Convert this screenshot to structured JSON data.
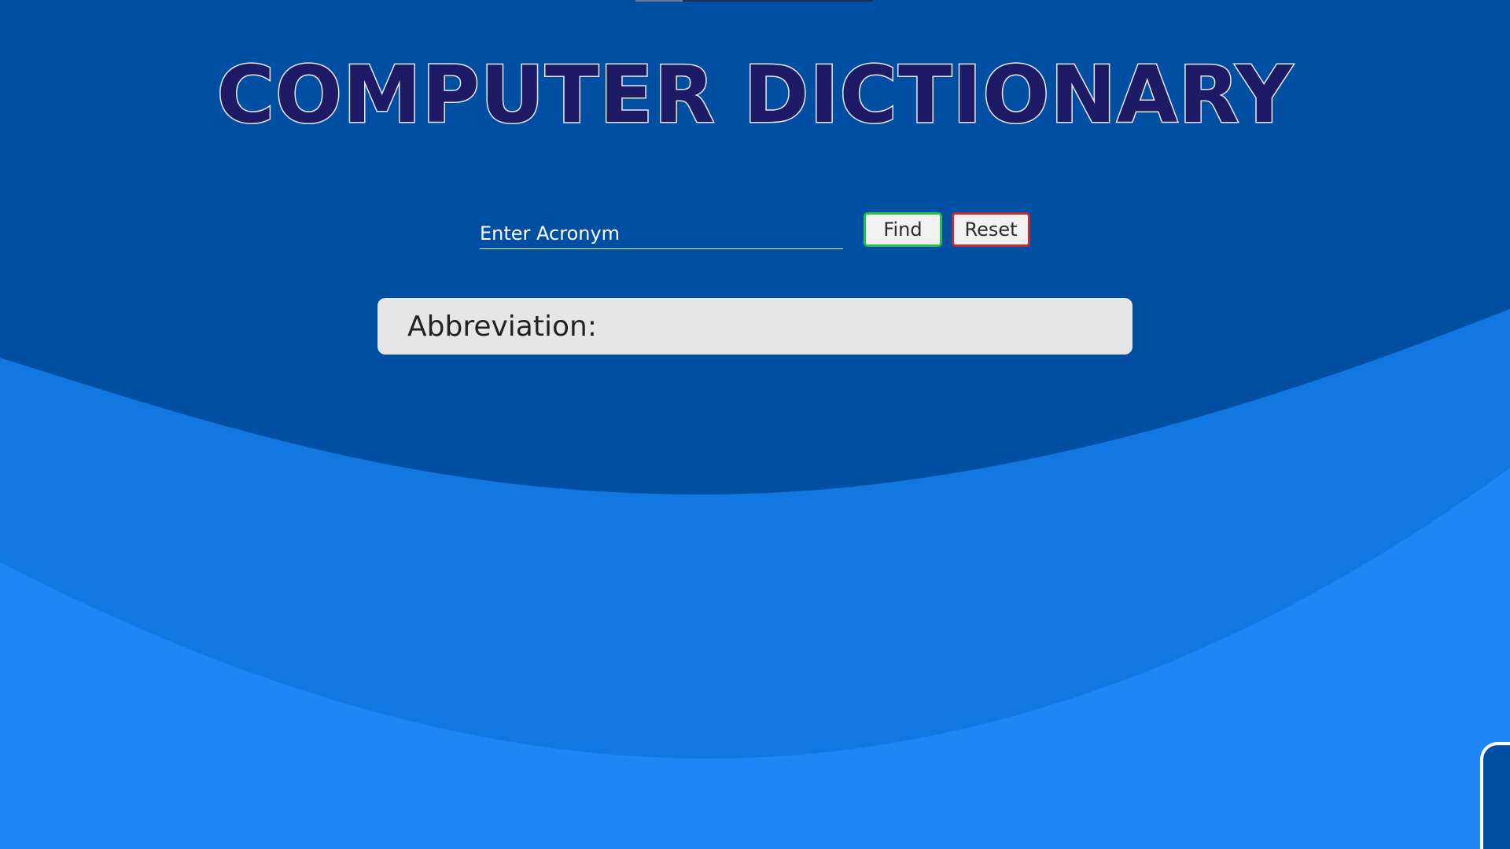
{
  "page": {
    "title": "COMPUTER DICTIONARY",
    "colors": {
      "background_top": "#004fa2",
      "wave_mid": "#1277e0",
      "wave_bottom": "#2186f5",
      "title_fill": "#1e1a66",
      "title_outline": "#e6e8f4",
      "find_border": "#23c24a",
      "reset_border": "#c62a34",
      "result_bg": "#e6e6e6"
    }
  },
  "search": {
    "value": "",
    "placeholder": "Enter Acronym",
    "find_label": "Find",
    "reset_label": "Reset"
  },
  "result": {
    "label": "Abbreviation:",
    "value": ""
  }
}
